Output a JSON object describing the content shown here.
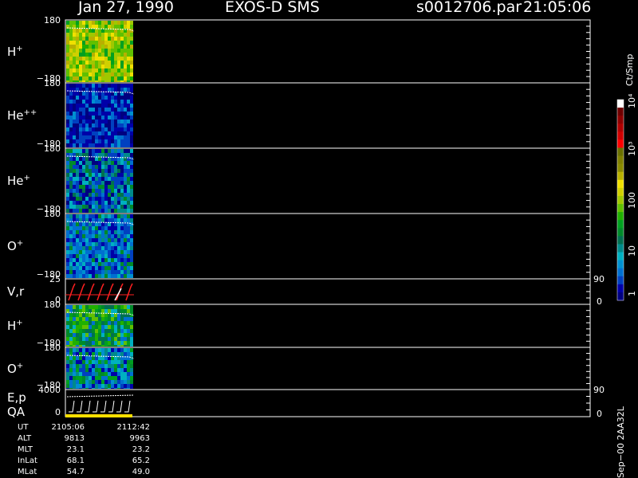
{
  "header": {
    "date": "Jan 27, 1990",
    "instrument": "EXOS-D SMS",
    "file": "s0012706.par",
    "time": "21:05:06"
  },
  "colorbar": {
    "unit": "Ct/Smp",
    "tick_labels": [
      "1",
      "10",
      "100",
      "10³",
      "10⁴"
    ],
    "colors": [
      "#000080",
      "#0000a8",
      "#0040c0",
      "#0070d0",
      "#0090d0",
      "#00b0c0",
      "#008a8a",
      "#007050",
      "#008a2a",
      "#00a020",
      "#20b000",
      "#60c000",
      "#a0c800",
      "#d0d000",
      "#f0e000",
      "#b8b000",
      "#8a8a00",
      "#808000",
      "#6a7000",
      "#ff0000",
      "#d00000",
      "#b00000",
      "#900000",
      "#700000",
      "#ffffff"
    ]
  },
  "panels": [
    {
      "id": "h",
      "label": "H",
      "charge": "+",
      "y_top": "180",
      "y_bot": "−180"
    },
    {
      "id": "hepp",
      "label": "He",
      "charge": "++",
      "y_top": "180",
      "y_bot": "−180"
    },
    {
      "id": "hep",
      "label": "He",
      "charge": "+",
      "y_top": "180",
      "y_bot": "−180"
    },
    {
      "id": "o",
      "label": "O",
      "charge": "+",
      "y_top": "180",
      "y_bot": "−180"
    },
    {
      "id": "vr",
      "label": "V,r",
      "charge": "",
      "y_top": "25",
      "y_bot": "0",
      "right_top": "90",
      "right_bot": "0"
    },
    {
      "id": "h2",
      "label": "H",
      "charge": "+",
      "y_top": "180",
      "y_bot": "−180"
    },
    {
      "id": "o2",
      "label": "O",
      "charge": "+",
      "y_top": "180",
      "y_bot": "−180"
    },
    {
      "id": "ep",
      "label": "E,p",
      "label2": "QA",
      "charge": "",
      "y_top": "4000",
      "y_bot": "0",
      "right_top": "90",
      "right_bot": "0"
    }
  ],
  "ephemeris": {
    "rows": [
      {
        "label": "UT",
        "v1": "2105:06",
        "v2": "2112:42"
      },
      {
        "label": "ALT",
        "v1": "9813",
        "v2": "9963"
      },
      {
        "label": "MLT",
        "v1": "23.1",
        "v2": "23.2"
      },
      {
        "label": "InLat",
        "v1": "68.1",
        "v2": "65.2"
      },
      {
        "label": "MLat",
        "v1": "54.7",
        "v2": "49.0"
      }
    ]
  },
  "footer": {
    "stamp": "Sep−00 2AA32L"
  },
  "chart_data": {
    "type": "heatmap",
    "title": "Jan 27, 1990   EXOS-D SMS",
    "x_range_ut": [
      "2105:06",
      "2112:42"
    ],
    "panels": [
      {
        "name": "H+",
        "ylim": [
          -180,
          180
        ],
        "level": "medium-high",
        "dominant": "green-yellow"
      },
      {
        "name": "He++",
        "ylim": [
          -180,
          180
        ],
        "level": "low",
        "dominant": "blue"
      },
      {
        "name": "He+",
        "ylim": [
          -180,
          180
        ],
        "level": "low",
        "dominant": "blue"
      },
      {
        "name": "O+",
        "ylim": [
          -180,
          180
        ],
        "level": "low",
        "dominant": "blue-cyan"
      },
      {
        "name": "V,r",
        "ylim": [
          0,
          25
        ],
        "right_ylim": [
          0,
          90
        ]
      },
      {
        "name": "H+",
        "ylim": [
          -180,
          180
        ],
        "level": "medium",
        "dominant": "green"
      },
      {
        "name": "O+",
        "ylim": [
          -180,
          180
        ],
        "level": "low",
        "dominant": "blue-cyan"
      },
      {
        "name": "E,p QA",
        "ylim": [
          0,
          4000
        ],
        "right_ylim": [
          0,
          90
        ]
      }
    ],
    "colorbar_scale": "log",
    "colorbar_range": [
      1,
      10000
    ]
  }
}
